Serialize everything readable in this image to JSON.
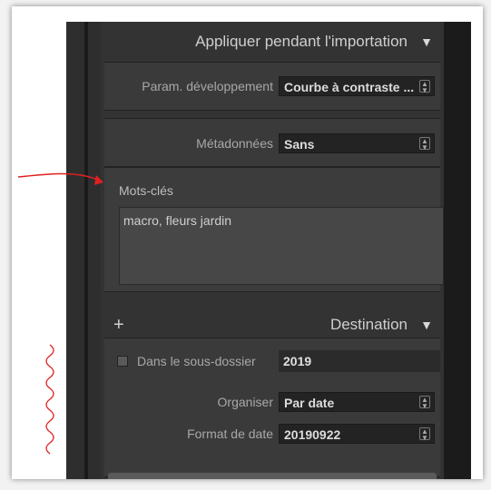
{
  "import_settings": {
    "title": "Appliquer pendant l'importation",
    "develop_label": "Param. développement",
    "develop_value": "Courbe à contraste ...",
    "metadata_label": "Métadonnées",
    "metadata_value": "Sans",
    "keywords_label": "Mots-clés",
    "keywords_value": "macro, fleurs jardin"
  },
  "destination": {
    "title": "Destination",
    "add_icon": "+",
    "subfolder_label": "Dans le sous-dossier",
    "subfolder_value": "2019",
    "organise_label": "Organiser",
    "organise_value": "Par date",
    "date_format_label": "Format de date",
    "date_format_value": "20190922"
  },
  "colors": {
    "panel_bg": "#333333",
    "annotation_red": "#e02020"
  },
  "icons": {
    "collapse": "triangle-down-icon",
    "select_arrows": "up-down-arrows-icon"
  }
}
